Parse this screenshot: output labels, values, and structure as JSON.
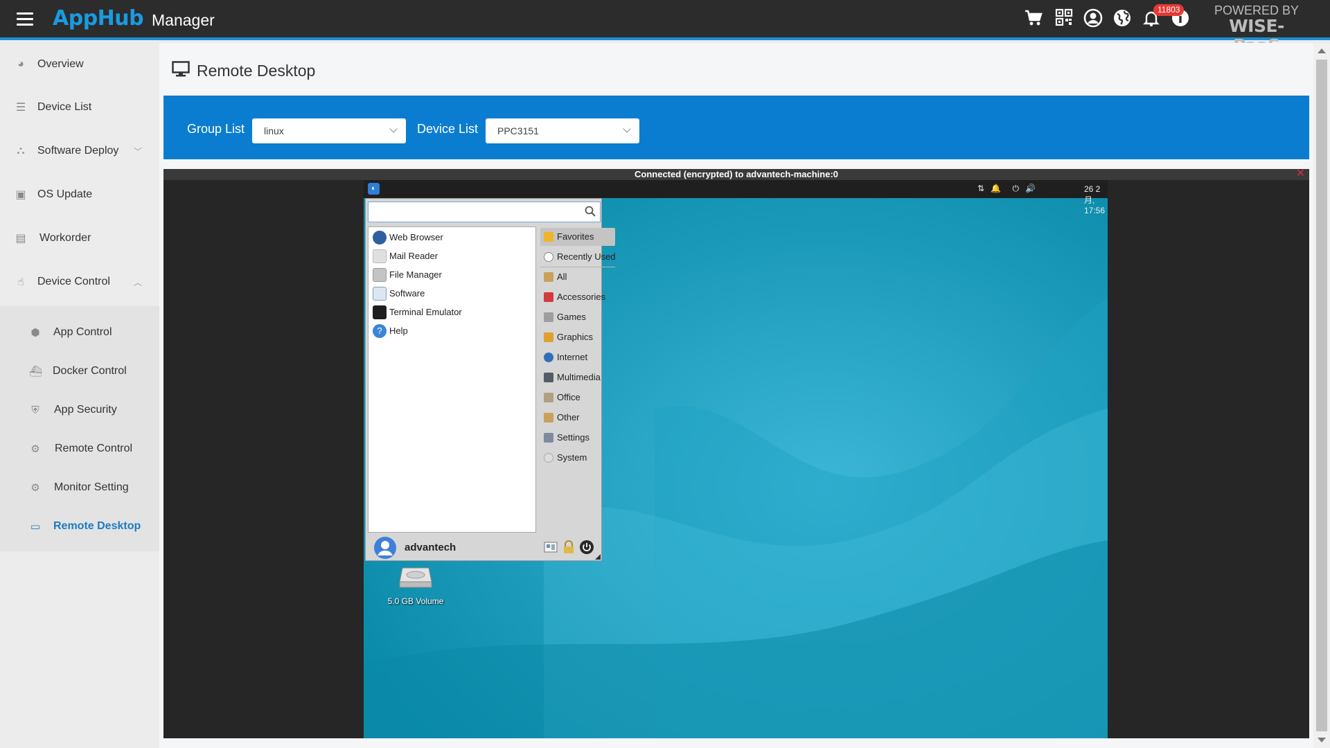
{
  "header": {
    "logo": "AppHub",
    "title": "Manager",
    "notification_count": "11803",
    "powered_by": "POWERED BY",
    "brand": "WISE-PaaS",
    "icons": [
      "cart-icon",
      "qr-code-icon",
      "user-icon",
      "globe-icon",
      "bell-icon",
      "info-icon"
    ]
  },
  "sidebar": {
    "items": [
      {
        "label": "Overview",
        "icon": "chart-pie-icon"
      },
      {
        "label": "Device List",
        "icon": "list-icon"
      },
      {
        "label": "Software Deploy",
        "icon": "sitemap-icon"
      },
      {
        "label": "OS Update",
        "icon": "package-icon"
      },
      {
        "label": "Workorder",
        "icon": "clipboard-icon"
      },
      {
        "label": "Device Control",
        "icon": "hand-pointer-icon"
      }
    ],
    "subitems": [
      {
        "label": "App Control",
        "icon": "android-icon"
      },
      {
        "label": "Docker Control",
        "icon": "docker-icon"
      },
      {
        "label": "App Security",
        "icon": "shield-icon"
      },
      {
        "label": "Remote Control",
        "icon": "gear-icon"
      },
      {
        "label": "Monitor Setting",
        "icon": "gears-icon"
      },
      {
        "label": "Remote Desktop",
        "icon": "monitor-icon"
      }
    ],
    "active": "Remote Desktop"
  },
  "main": {
    "title": "Remote Desktop",
    "group_label": "Group List",
    "group_value": "linux",
    "device_label": "Device List",
    "device_value": "PPC3151"
  },
  "viewer": {
    "status": "Connected (encrypted) to advantech-machine:0",
    "clock": "26 2月, 17:56",
    "desktop_icon_label": "5.0 GB Volume"
  },
  "menu": {
    "search_value": "",
    "apps": [
      {
        "label": "Web Browser",
        "icon": "globe-icon",
        "color": "#2f5f9e"
      },
      {
        "label": "Mail Reader",
        "icon": "mail-icon",
        "color": "#d9d9d9"
      },
      {
        "label": "File Manager",
        "icon": "folder-icon",
        "color": "#bdbdbd"
      },
      {
        "label": "Software",
        "icon": "software-icon",
        "color": "#7aa2c8"
      },
      {
        "label": "Terminal Emulator",
        "icon": "terminal-icon",
        "color": "#1e1e1e"
      },
      {
        "label": "Help",
        "icon": "help-icon",
        "color": "#3a86d6"
      }
    ],
    "categories": [
      {
        "label": "Favorites",
        "icon": "star-icon",
        "color": "#f0b429"
      },
      {
        "label": "Recently Used",
        "icon": "clock-icon",
        "color": "#8c8c8c"
      },
      {
        "label": "All",
        "icon": "folder-icon",
        "color": "#c9a15a"
      },
      {
        "label": "Accessories",
        "icon": "accessories-icon",
        "color": "#d33a3a"
      },
      {
        "label": "Games",
        "icon": "games-icon",
        "color": "#9e9e9e"
      },
      {
        "label": "Graphics",
        "icon": "graphics-icon",
        "color": "#e0a030"
      },
      {
        "label": "Internet",
        "icon": "globe-icon",
        "color": "#2f6fb8"
      },
      {
        "label": "Multimedia",
        "icon": "multimedia-icon",
        "color": "#555c66"
      },
      {
        "label": "Office",
        "icon": "office-icon",
        "color": "#b0a080"
      },
      {
        "label": "Other",
        "icon": "folder-icon",
        "color": "#c9a15a"
      },
      {
        "label": "Settings",
        "icon": "settings-icon",
        "color": "#7d8ba0"
      },
      {
        "label": "System",
        "icon": "system-icon",
        "color": "#b8b8b8"
      }
    ],
    "user": "advantech"
  }
}
